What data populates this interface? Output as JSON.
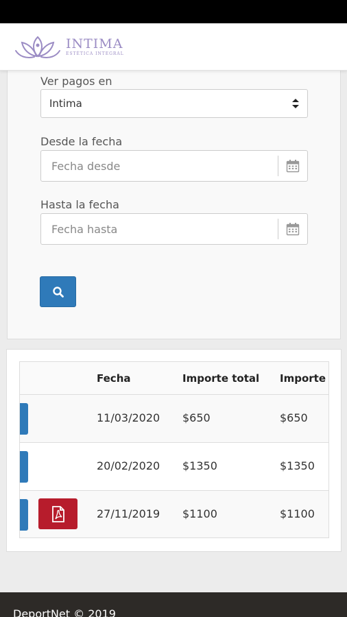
{
  "brand": {
    "name": "INTIMA",
    "tagline": "ESTÉTICA INTEGRAL",
    "color": "#9b8cc4"
  },
  "header": {
    "avatar_icon": "user-avatar",
    "menu_icon": "hamburger-icon"
  },
  "filters": {
    "location_label": "Ver pagos en",
    "location_value": "Intima",
    "from_label": "Desde la fecha",
    "from_placeholder": "Fecha desde",
    "to_label": "Hasta la fecha",
    "to_placeholder": "Fecha hasta",
    "search_icon": "search-icon"
  },
  "table": {
    "columns": [
      "",
      "Fecha",
      "Importe total",
      "Importe"
    ],
    "rows": [
      {
        "fecha": "11/03/2020",
        "importe_total": "$650",
        "importe": "$650",
        "has_pdf": false
      },
      {
        "fecha": "20/02/2020",
        "importe_total": "$1350",
        "importe": "$1350",
        "has_pdf": false
      },
      {
        "fecha": "27/11/2019",
        "importe_total": "$1100",
        "importe": "$1100",
        "has_pdf": true
      }
    ]
  },
  "footer": {
    "text": "DeportNet © 2019"
  },
  "colors": {
    "primary": "#2f7ab9",
    "pdf": "#b71c2c",
    "footer_bg": "#2d2a27"
  }
}
